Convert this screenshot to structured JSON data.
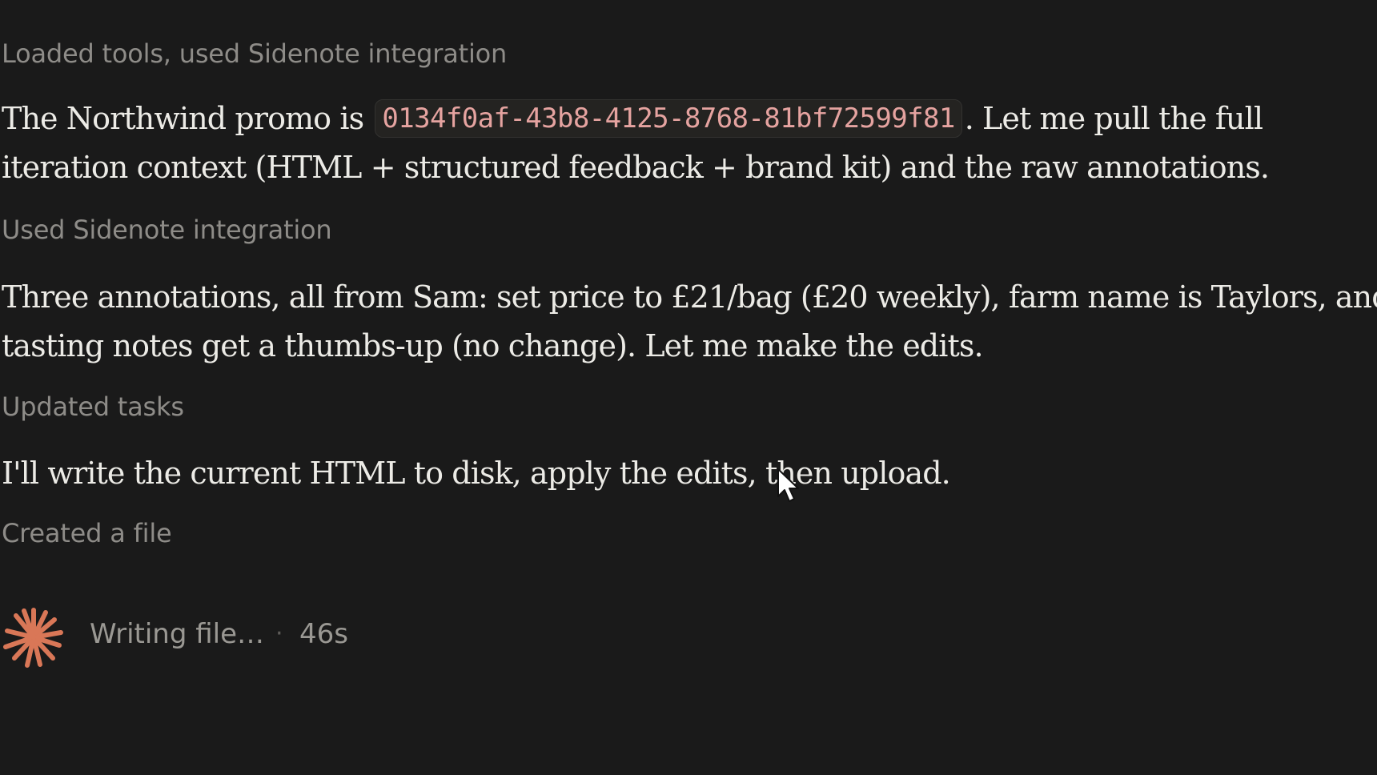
{
  "transcript": {
    "tool_1": "Loaded tools, used Sidenote integration",
    "message_1": {
      "before": "The Northwind promo is",
      "id": "0134f0af-43b8-4125-8768-81bf72599f81",
      "after": ". Let me pull the full",
      "line2": "iteration context (HTML + structured feedback + brand kit) and the raw annotations."
    },
    "tool_2": "Used Sidenote integration",
    "message_2": {
      "line1": "Three annotations, all from Sam: set price to £21/bag (£20 weekly), farm name is Taylors, and",
      "line2": "tasting notes get a thumbs-up (no change). Let me make the edits."
    },
    "tool_3": "Updated tasks",
    "message_3": "I'll write the current HTML to disk, apply the edits, then upload.",
    "tool_4": "Created a file"
  },
  "status": {
    "label": "Writing file…",
    "separator": "·",
    "elapsed": "46s",
    "spinner_icon": "sparkle-spinner-icon"
  },
  "colors": {
    "background": "#1a1a1a",
    "prose_text": "#ecebe6",
    "muted_text": "#8e8c88",
    "code_text": "#e5a3a0",
    "accent_spinner": "#d97757"
  }
}
